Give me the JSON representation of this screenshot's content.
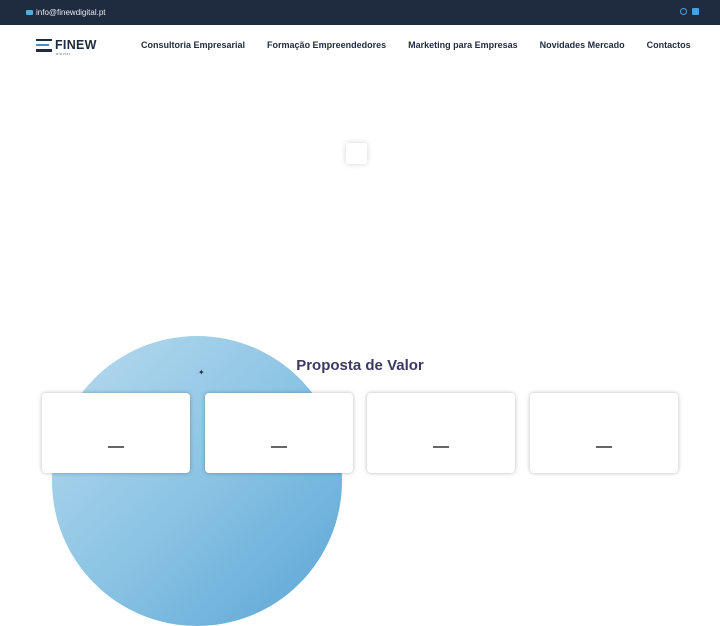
{
  "topbar": {
    "email": "info@finewdigital.pt",
    "icons": [
      "mail-icon",
      "instagram-icon",
      "linkedin-icon"
    ]
  },
  "brand": {
    "logo_text": "FINEW",
    "logo_sub": "DIGITAL",
    "colors": {
      "dark": "#1f2b3e",
      "accent": "#3d8fd0"
    }
  },
  "nav": {
    "items": [
      {
        "label": "Consultoria Empresarial"
      },
      {
        "label": "Formação Empreendedores"
      },
      {
        "label": "Marketing para Empresas"
      },
      {
        "label": "Novidades Mercado"
      },
      {
        "label": "Contactos"
      }
    ]
  },
  "section": {
    "title": "Proposta de Valor",
    "title_color": "#3b3a60"
  }
}
